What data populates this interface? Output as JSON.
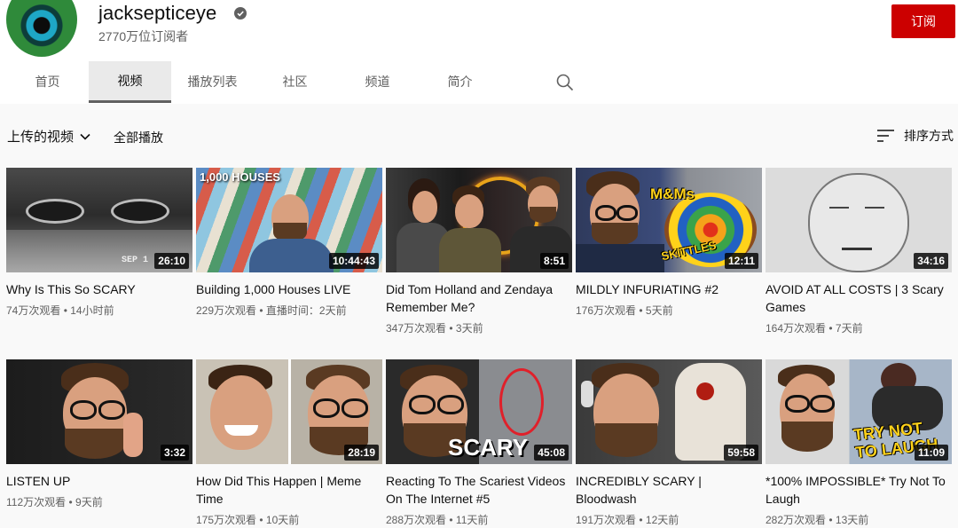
{
  "channel": {
    "name": "jacksepticeye",
    "subscribers": "2770万位订阅者",
    "subscribe_label": "订阅"
  },
  "tabs": [
    {
      "label": "首页"
    },
    {
      "label": "视频"
    },
    {
      "label": "播放列表"
    },
    {
      "label": "社区"
    },
    {
      "label": "频道"
    },
    {
      "label": "简介"
    }
  ],
  "toolbar": {
    "uploads_label": "上传的视频",
    "play_all_label": "全部播放",
    "sort_label": "排序方式"
  },
  "videos": [
    {
      "title": "Why Is This So SCARY",
      "views": "74万次观看",
      "age": "14小时前",
      "duration": "26:10",
      "overlay": "SEP 1"
    },
    {
      "title": "Building 1,000 Houses LIVE",
      "views": "229万次观看",
      "age": "直播时间：2天前",
      "duration": "10:44:43",
      "overlay": "1,000 HOUSES"
    },
    {
      "title": "Did Tom Holland and Zendaya Remember Me?",
      "views": "347万次观看",
      "age": "3天前",
      "duration": "8:51"
    },
    {
      "title": "MILDLY INFURIATING #2",
      "views": "176万次观看",
      "age": "5天前",
      "duration": "12:11",
      "overlay": "M&Ms",
      "overlay2": "SKITTLES"
    },
    {
      "title": "AVOID AT ALL COSTS | 3 Scary Games",
      "views": "164万次观看",
      "age": "7天前",
      "duration": "34:16"
    },
    {
      "title": "LISTEN UP",
      "views": "112万次观看",
      "age": "9天前",
      "duration": "3:32"
    },
    {
      "title": "How Did This Happen | Meme Time",
      "views": "175万次观看",
      "age": "10天前",
      "duration": "28:19"
    },
    {
      "title": "Reacting To The Scariest Videos On The Internet #5",
      "views": "288万次观看",
      "age": "11天前",
      "duration": "45:08",
      "overlay": "SCARY"
    },
    {
      "title": "INCREDIBLY SCARY | Bloodwash",
      "views": "191万次观看",
      "age": "12天前",
      "duration": "59:58"
    },
    {
      "title": "*100% IMPOSSIBLE* Try Not To Laugh",
      "views": "282万次观看",
      "age": "13天前",
      "duration": "11:09",
      "overlay": "TRY NOT TO LAUGH"
    }
  ],
  "meta_separator": " • "
}
